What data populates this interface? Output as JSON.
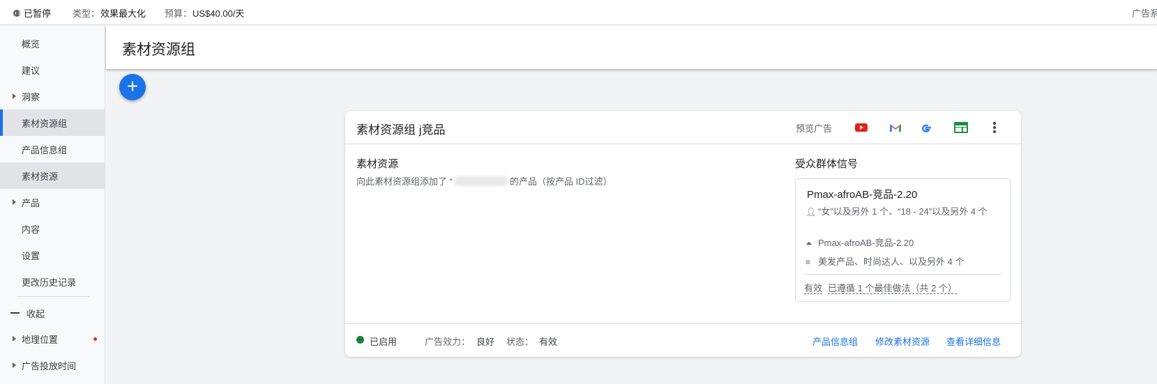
{
  "topbar": {
    "status": "已暂停",
    "type_label": "类型：",
    "type_value": "效果最大化",
    "budget_label": "预算：",
    "budget_value": "US$40.00/天",
    "right_text": "广告系"
  },
  "sidebar": {
    "items": [
      "概览",
      "建议",
      "洞察",
      "素材资源组",
      "产品信息组",
      "素材资源",
      "产品",
      "内容",
      "设置",
      "更改历史记录"
    ],
    "collapse": "收起",
    "geo": "地理位置",
    "last": "广告投放时间"
  },
  "page": {
    "title": "素材资源组",
    "add": "+"
  },
  "card": {
    "title": "素材资源组 j竞品",
    "preview": "预览广告",
    "assets_title": "素材资源",
    "assets_desc_prefix": "向此素材资源组添加了 “",
    "assets_desc_suffix": "的产品（按产品 ID过滤）",
    "audience_title": "受众群体信号",
    "audience": {
      "name": "Pmax-afroAB-竞品-2.20",
      "demographics": "“女”以及另外 1 个、“18 - 24”以及另外 4 个",
      "segment": "Pmax-afroAB-竞品-2.20",
      "interests": "美发产品、时尚达人、以及另外 4 个",
      "valid": "有效",
      "best_practice": "已遵循 1 个最佳做法（共 2 个）"
    },
    "footer": {
      "status": "已启用",
      "strength_label": "广告效力：",
      "strength": "良好",
      "state_label": "状态：",
      "state": "有效",
      "links": [
        "产品信息组",
        "修改素材资源",
        "查看详细信息"
      ]
    }
  },
  "colors": {
    "accent": "#1a73e8",
    "enabled": "#188038"
  }
}
